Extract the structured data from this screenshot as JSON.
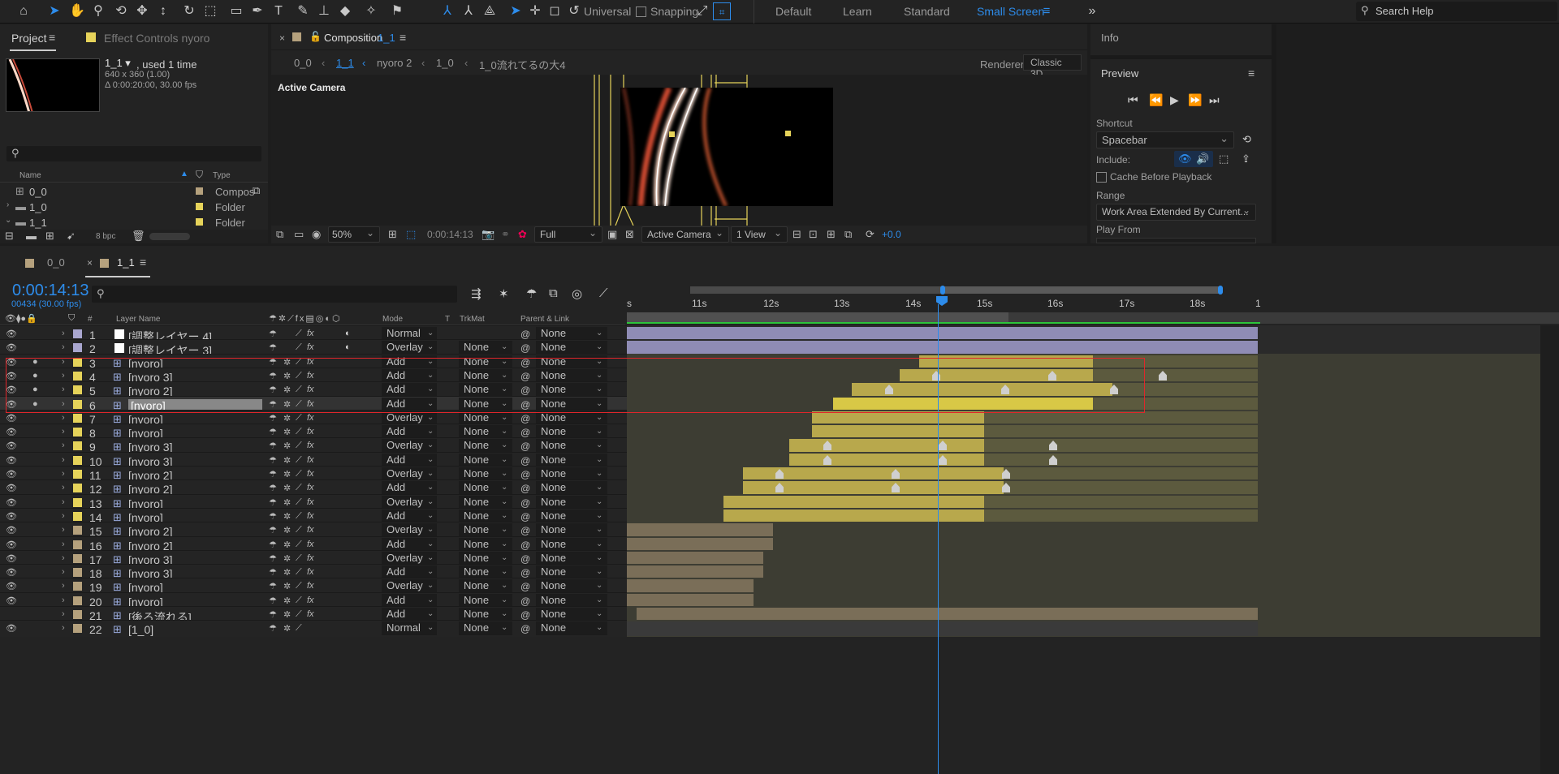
{
  "toolbar": {
    "universal_label": "Universal",
    "snapping_label": "Snapping",
    "workspaces": [
      "Default",
      "Learn",
      "Standard",
      "Small Screen"
    ],
    "search_placeholder": "Search Help"
  },
  "project": {
    "tab_label": "Project",
    "effect_controls_label": "Effect Controls nyoro",
    "comp_name": "1_1 ▾",
    "comp_used": ", used 1 time",
    "comp_size": "640 x 360 (1.00)",
    "comp_duration": "Δ 0:00:20:00, 30.00 fps",
    "col_name": "Name",
    "col_type": "Type",
    "items": [
      {
        "name": "0_0",
        "type": "Compos"
      },
      {
        "name": "1_0",
        "type": "Folder"
      },
      {
        "name": "1_1",
        "type": "Folder"
      }
    ],
    "bpc": "8 bpc"
  },
  "comp": {
    "tab_prefix": "Composition",
    "tab_comp": "1_1",
    "breadcrumbs": [
      "0_0",
      "1_1",
      "nyoro 2",
      "1_0",
      "1_0流れてるの大4"
    ],
    "renderer_label": "Renderer:",
    "renderer_value": "Classic 3D",
    "active_camera": "Active Camera",
    "zoom": "50%",
    "timecode": "0:00:14:13",
    "resolution": "Full",
    "camera": "Active Camera",
    "views": "1 View",
    "exposure": "+0.0"
  },
  "right": {
    "info": "Info",
    "preview": "Preview",
    "shortcut_label": "Shortcut",
    "shortcut_value": "Spacebar",
    "include_label": "Include:",
    "cache_label": "Cache Before Playback",
    "range_label": "Range",
    "range_value": "Work Area Extended By Current...",
    "play_from": "Play From"
  },
  "timeline": {
    "tabs": [
      "0_0",
      "1_1"
    ],
    "timecode": "0:00:14:13",
    "frames": "00434 (30.00 fps)",
    "col_num": "#",
    "col_layer": "Layer Name",
    "col_mode": "Mode",
    "col_t": "T",
    "col_trkmat": "TrkMat",
    "col_parent": "Parent & Link",
    "ruler": [
      "s",
      "11s",
      "12s",
      "13s",
      "14s",
      "15s",
      "16s",
      "17s",
      "18s",
      "1"
    ],
    "layers": [
      {
        "n": "1",
        "name": "[調整レイヤー 4]",
        "mode": "Normal",
        "trk": "",
        "parent": "None"
      },
      {
        "n": "2",
        "name": "[調整レイヤー 3]",
        "mode": "Overlay",
        "trk": "None",
        "parent": "None"
      },
      {
        "n": "3",
        "name": "[nyoro]",
        "mode": "Add",
        "trk": "None",
        "parent": "None"
      },
      {
        "n": "4",
        "name": "[nyoro 3]",
        "mode": "Add",
        "trk": "None",
        "parent": "None"
      },
      {
        "n": "5",
        "name": "[nyoro 2]",
        "mode": "Add",
        "trk": "None",
        "parent": "None"
      },
      {
        "n": "6",
        "name": "[nyoro]",
        "mode": "Add",
        "trk": "None",
        "parent": "None"
      },
      {
        "n": "7",
        "name": "[nyoro]",
        "mode": "Overlay",
        "trk": "None",
        "parent": "None"
      },
      {
        "n": "8",
        "name": "[nyoro]",
        "mode": "Add",
        "trk": "None",
        "parent": "None"
      },
      {
        "n": "9",
        "name": "[nyoro 3]",
        "mode": "Overlay",
        "trk": "None",
        "parent": "None"
      },
      {
        "n": "10",
        "name": "[nyoro 3]",
        "mode": "Add",
        "trk": "None",
        "parent": "None"
      },
      {
        "n": "11",
        "name": "[nyoro 2]",
        "mode": "Overlay",
        "trk": "None",
        "parent": "None"
      },
      {
        "n": "12",
        "name": "[nyoro 2]",
        "mode": "Add",
        "trk": "None",
        "parent": "None"
      },
      {
        "n": "13",
        "name": "[nyoro]",
        "mode": "Overlay",
        "trk": "None",
        "parent": "None"
      },
      {
        "n": "14",
        "name": "[nyoro]",
        "mode": "Add",
        "trk": "None",
        "parent": "None"
      },
      {
        "n": "15",
        "name": "[nyoro 2]",
        "mode": "Overlay",
        "trk": "None",
        "parent": "None"
      },
      {
        "n": "16",
        "name": "[nyoro 2]",
        "mode": "Add",
        "trk": "None",
        "parent": "None"
      },
      {
        "n": "17",
        "name": "[nyoro 3]",
        "mode": "Overlay",
        "trk": "None",
        "parent": "None"
      },
      {
        "n": "18",
        "name": "[nyoro 3]",
        "mode": "Add",
        "trk": "None",
        "parent": "None"
      },
      {
        "n": "19",
        "name": "[nyoro]",
        "mode": "Overlay",
        "trk": "None",
        "parent": "None"
      },
      {
        "n": "20",
        "name": "[nyoro]",
        "mode": "Add",
        "trk": "None",
        "parent": "None"
      },
      {
        "n": "21",
        "name": "[後ろ流れる]",
        "mode": "Add",
        "trk": "None",
        "parent": "None"
      },
      {
        "n": "22",
        "name": "[1_0]",
        "mode": "Normal",
        "trk": "None",
        "parent": "None"
      }
    ]
  },
  "colors": {
    "accent": "#2d8ceb",
    "label_yellow": "#e6d35a",
    "label_lavender": "#a9a6cf",
    "label_tan": "#b5a17d",
    "highlight_red": "#e0262b"
  }
}
